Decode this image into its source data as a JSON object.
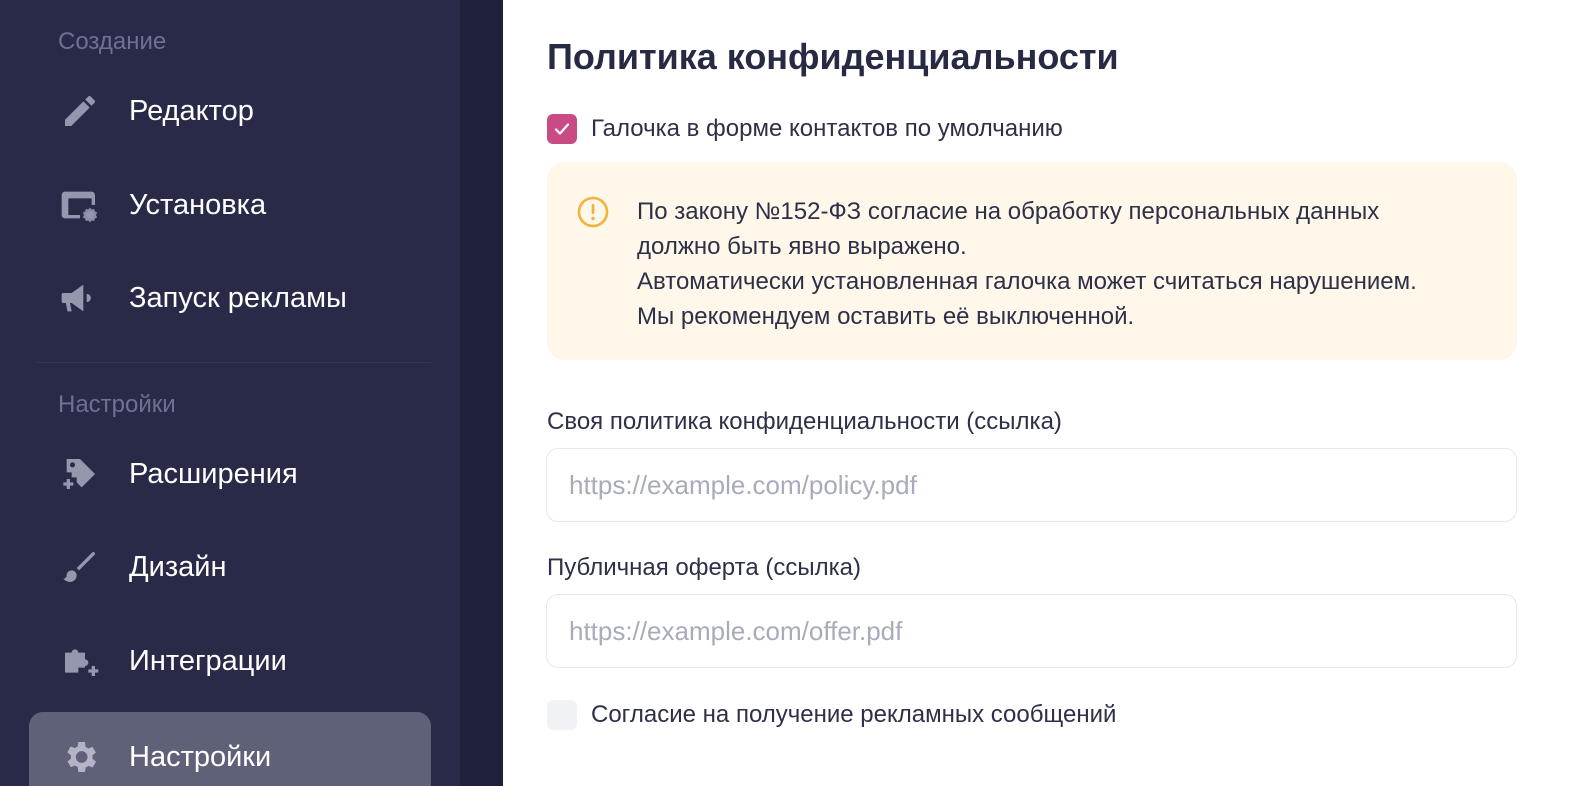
{
  "sidebar": {
    "sections": [
      {
        "title": "Создание"
      },
      {
        "title": "Настройки"
      }
    ],
    "items": [
      {
        "label": "Редактор",
        "icon": "pencil-icon"
      },
      {
        "label": "Установка",
        "icon": "window-gear-icon"
      },
      {
        "label": "Запуск рекламы",
        "icon": "megaphone-icon"
      },
      {
        "label": "Расширения",
        "icon": "tag-plus-icon"
      },
      {
        "label": "Дизайн",
        "icon": "brush-icon"
      },
      {
        "label": "Интеграции",
        "icon": "puzzle-plus-icon"
      },
      {
        "label": "Настройки",
        "icon": "gear-icon",
        "active": true
      }
    ]
  },
  "main": {
    "title": "Политика конфиденциальности",
    "default_checkbox": {
      "label": "Галочка в форме контактов по умолчанию",
      "checked": true
    },
    "alert": {
      "icon": "exclamation-circle-icon",
      "lines": [
        "По закону №152-ФЗ согласие на обработку персональных данных",
        "должно быть явно выражено.",
        "Автоматически установленная галочка может считаться нарушением.",
        "Мы рекомендуем оставить её выключенной."
      ]
    },
    "policy_field": {
      "label": "Своя политика конфиденциальности (ссылка)",
      "value": "",
      "placeholder": "https://example.com/policy.pdf"
    },
    "offer_field": {
      "label": "Публичная оферта (ссылка)",
      "value": "",
      "placeholder": "https://example.com/offer.pdf"
    },
    "ads_checkbox": {
      "label": "Согласие на получение рекламных сообщений",
      "checked": false
    }
  },
  "colors": {
    "sidebar_bg": "#282a47",
    "accent": "#c84b86",
    "alert_bg": "#fff7ea",
    "alert_icon": "#f2b33d"
  }
}
